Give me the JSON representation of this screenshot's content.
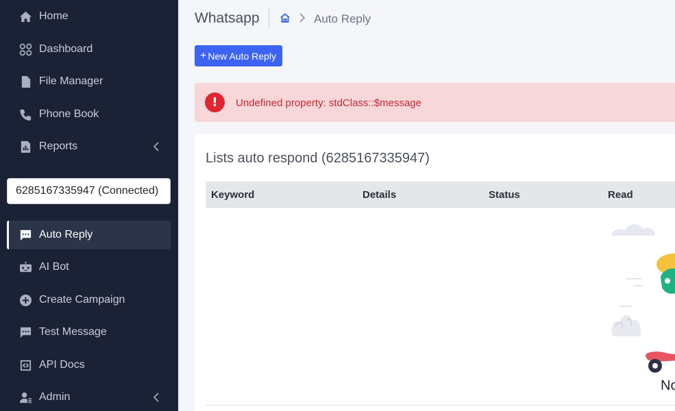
{
  "sidebar": {
    "items": [
      {
        "label": "Home",
        "icon": "home-icon"
      },
      {
        "label": "Dashboard",
        "icon": "dashboard-icon"
      },
      {
        "label": "File Manager",
        "icon": "file-icon"
      },
      {
        "label": "Phone Book",
        "icon": "phone-icon"
      },
      {
        "label": "Reports",
        "icon": "reports-icon"
      },
      {
        "label": "Auto Reply",
        "icon": "message-icon"
      },
      {
        "label": "AI Bot",
        "icon": "robot-icon"
      },
      {
        "label": "Create Campaign",
        "icon": "plus-circle-icon"
      },
      {
        "label": "Test Message",
        "icon": "chat-icon"
      },
      {
        "label": "API Docs",
        "icon": "code-icon"
      },
      {
        "label": "Admin",
        "icon": "admin-icon"
      }
    ],
    "device": "6285167335947 (Connected)"
  },
  "header": {
    "title": "Whatsapp",
    "breadcrumb_current": "Auto Reply"
  },
  "toolbar": {
    "new_button_plus": "+",
    "new_button_label": "New Auto Reply"
  },
  "alert": {
    "icon_glyph": "!",
    "message": "Undefined property: stdClass::$message"
  },
  "card": {
    "title": "Lists auto respond (6285167335947)",
    "columns": [
      "Keyword",
      "Details",
      "Status",
      "Read"
    ],
    "empty_text": "No"
  },
  "colors": {
    "sidebar_bg": "#1b2236",
    "accent": "#3d63f2",
    "alert_bg": "#f8d7da",
    "alert_text": "#c2282f"
  }
}
